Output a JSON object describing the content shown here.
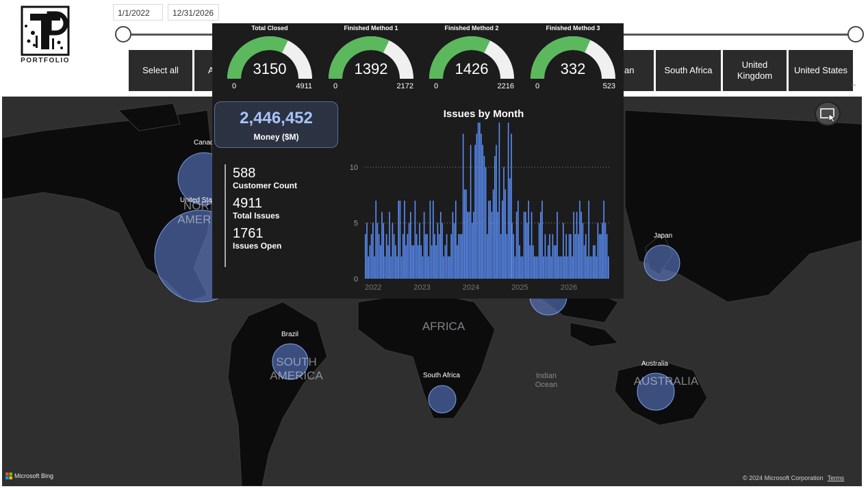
{
  "logo": {
    "text": "PORTFOLIO"
  },
  "date_range": {
    "start": "1/1/2022",
    "end": "12/31/2026"
  },
  "country_slicer": {
    "items": [
      {
        "label": "Select all"
      },
      {
        "label": "A"
      },
      {
        "label": "an"
      },
      {
        "label": "South Africa"
      },
      {
        "label": "United Kingdom"
      },
      {
        "label": "United States"
      }
    ],
    "more": "..."
  },
  "map": {
    "labels": {
      "canada": "Canada",
      "united_states": "United States",
      "brazil": "Brazil",
      "south_africa": "South Africa",
      "australia": "Australia",
      "japan": "Japan"
    },
    "continents": {
      "north_america": "NORTH AMERICA",
      "south_america": "SOUTH AMERICA",
      "africa": "AFRICA",
      "australia": "AUSTRALIA"
    },
    "ocean": "Indian Ocean",
    "bing": "Microsoft Bing",
    "copyright": "© 2024 Microsoft Corporation",
    "terms": "Terms",
    "bubble_color": "#5b7cc9"
  },
  "gauges": [
    {
      "title": "Total Closed",
      "value": 3150,
      "min": 0,
      "max": 4911,
      "value_text": "3150",
      "min_text": "0",
      "max_text": "4911"
    },
    {
      "title": "Finished Method 1",
      "value": 1392,
      "min": 0,
      "max": 2172,
      "value_text": "1392",
      "min_text": "0",
      "max_text": "2172"
    },
    {
      "title": "Finished Method 2",
      "value": 1426,
      "min": 0,
      "max": 2216,
      "value_text": "1426",
      "min_text": "0",
      "max_text": "2216"
    },
    {
      "title": "Finished Method 3",
      "value": 332,
      "min": 0,
      "max": 523,
      "value_text": "332",
      "min_text": "0",
      "max_text": "523"
    }
  ],
  "gauge_colors": {
    "fill": "#5cb85c",
    "track": "#f0f0f0"
  },
  "money": {
    "value": "2,446,452",
    "label": "Money ($M)"
  },
  "kpis": [
    {
      "value": "588",
      "label": "Customer Count"
    },
    {
      "value": "4911",
      "label": "Total Issues"
    },
    {
      "value": "1761",
      "label": "Issues Open"
    }
  ],
  "chart_data": {
    "type": "bar",
    "title": "Issues by Month",
    "xlabel": "",
    "ylabel": "",
    "ylim": [
      0,
      14
    ],
    "yticks": [
      0,
      5,
      10
    ],
    "xticks": [
      "2022",
      "2023",
      "2024",
      "2025",
      "2026"
    ],
    "color": "#5b8ff9",
    "grid": "horizontal dotted",
    "segments": [
      {
        "from": "2022",
        "to": "2024",
        "low": 2,
        "high": 7
      },
      {
        "from": "2024",
        "to": "2025",
        "low": 4,
        "high": 14
      },
      {
        "from": "2025",
        "to": "2026-12",
        "low": 2,
        "high": 7
      }
    ]
  }
}
